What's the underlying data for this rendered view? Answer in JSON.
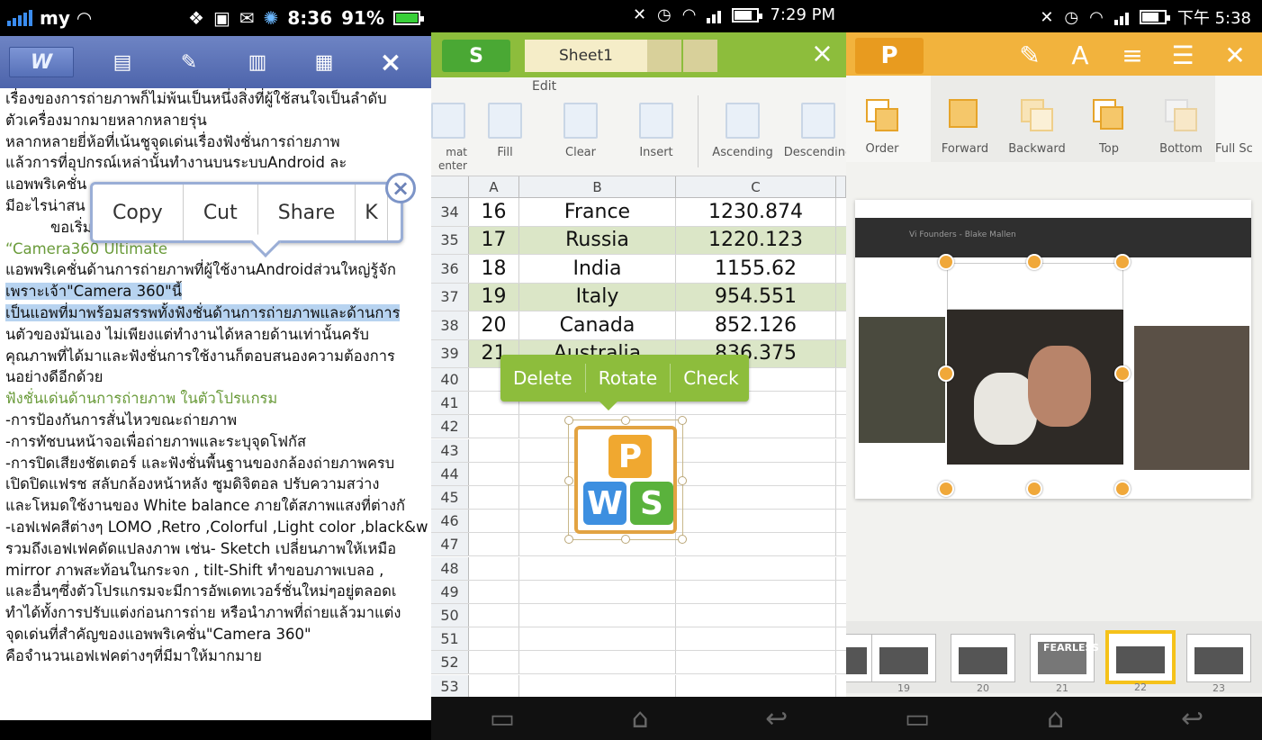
{
  "panel_writer": {
    "status": {
      "carrier": "my",
      "time": "8:36",
      "battery": "91%"
    },
    "toolbar": {
      "app_icon": "W",
      "icons": [
        "save-icon",
        "edit-icon",
        "document-icon",
        "clipboard-icon"
      ],
      "close": "×"
    },
    "lines": [
      "เรื่องของการถ่ายภาพก็ไม่พ้นเป็นหนึ่งสิ่งที่ผู้ใช้สนใจเป็นลำดับ",
      "ตัวเครื่องมากมายหลากหลายรุ่น",
      "หลากหลายยี่ห้อที่เน้นชูจุดเด่นเรื่องฟังชั่นการถ่ายภาพ",
      "แล้วการที่อุปกรณ์เหล่านั้นทำงานบนระบบAndroid ละ",
      "แอพพริเคชั่น",
      "มีอะไรน่าสน",
      "ขอเริ่ม",
      "“Camera360 Ultimate",
      "แอพพริเคชั่นด้านการถ่ายภาพที่ผู้ใช้งานAndroidส่วนใหญ่รู้จัก",
      "เพราะเจ้า\"Camera 360\"นี้",
      "เป็นแอพที่มาพร้อมสรรพทั้งฟังชั่นด้านการถ่ายภาพและด้านการ",
      "นตัวของมันเอง ไม่เพียงแต่ทำงานได้หลายด้านเท่านั้นครับ",
      "คุณภาพที่ได้มาและฟังชั่นการใช้งานก็ตอบสนองความต้องการ",
      "นอย่างดีอีกด้วย",
      "ฟังชั่นเด่นด้านการถ่ายภาพ ในตัวโปรแกรม",
      "-การป้องกันการสั่นไหวขณะถ่ายภาพ",
      "-การทัชบนหน้าจอเพื่อถ่ายภาพและระบุจุดโฟกัส",
      "-การปิดเสียงชัตเตอร์ และฟังชั่นพื้นฐานของกล้องถ่ายภาพครบ",
      "เปิดปิดแฟรช สลับกล้องหน้าหลัง ซูมดิจิตอล ปรับความสว่าง",
      "และโหมดใช้งานของ White balance ภายใต้สภาพแสงที่ต่างกั",
      "-เอฟเฟคสีต่างๆ LOMO ,Retro ,Colorful ,Light color ,black&w",
      "รวมถึงเอฟเฟคดัดแปลงภาพ เช่น- Sketch เปลี่ยนภาพให้เหมือ",
      "mirror ภาพสะท้อนในกระจก , tilt-Shift ทำขอบภาพเบลอ ,",
      "และอื่นๆซึ่งตัวโปรแกรมจะมีการอัพเดทเวอร์ชั่นใหม่ๆอยู่ตลอดเ",
      "ทำได้ทั้งการปรับแต่งก่อนการถ่าย หรือนำภาพที่ถ่ายแล้วมาแต่ง",
      "จุดเด่นที่สำคัญของแอพพริเคชั่น\"Camera 360\"",
      "คือจำนวนเอฟเฟคต่างๆที่มีมาให้มากมาย"
    ],
    "context_menu": {
      "items": [
        "Copy",
        "Cut",
        "Share",
        "K"
      ],
      "close": "×"
    }
  },
  "panel_sheets": {
    "status": {
      "time": "7:29 PM"
    },
    "app_icon": "S",
    "sheet_tab": "Sheet1",
    "close": "×",
    "ribbon": {
      "title": "Edit",
      "items": [
        "mat\nenter",
        "Fill",
        "Clear",
        "Insert",
        "Ascending",
        "Descending"
      ]
    },
    "columns": [
      "A",
      "B",
      "C"
    ],
    "rows": [
      {
        "n": "34",
        "a": "16",
        "b": "France",
        "c": "1230.874"
      },
      {
        "n": "35",
        "a": "17",
        "b": "Russia",
        "c": "1220.123"
      },
      {
        "n": "36",
        "a": "18",
        "b": "India",
        "c": "1155.62"
      },
      {
        "n": "37",
        "a": "19",
        "b": "Italy",
        "c": "954.551"
      },
      {
        "n": "38",
        "a": "20",
        "b": "Canada",
        "c": "852.126"
      },
      {
        "n": "39",
        "a": "21",
        "b": "Australia",
        "c": "836.375"
      }
    ],
    "empty_rows": [
      "40",
      "41",
      "42",
      "43",
      "44",
      "45",
      "46",
      "47",
      "48",
      "49",
      "50",
      "51",
      "52",
      "53"
    ],
    "image_menu": [
      "Delete",
      "Rotate",
      "Check"
    ],
    "logo_tiles": [
      "P",
      "W",
      "S"
    ]
  },
  "panel_presentation": {
    "status": {
      "time": "下午 5:38"
    },
    "app_icon": "P",
    "toolbar_icons": [
      "edit-icon",
      "text-icon",
      "align-icon",
      "list-icon",
      "close-icon"
    ],
    "ribbon_items": [
      "Order",
      "Forward",
      "Backward",
      "Top",
      "Bottom",
      "Full Sc"
    ],
    "slide_band_text": "Vi Founders - Blake Mallen",
    "thumbnails": [
      "19",
      "20",
      "21",
      "22",
      "23"
    ],
    "selected_thumbnail": "22",
    "thumb_text": "FEARLESS"
  }
}
